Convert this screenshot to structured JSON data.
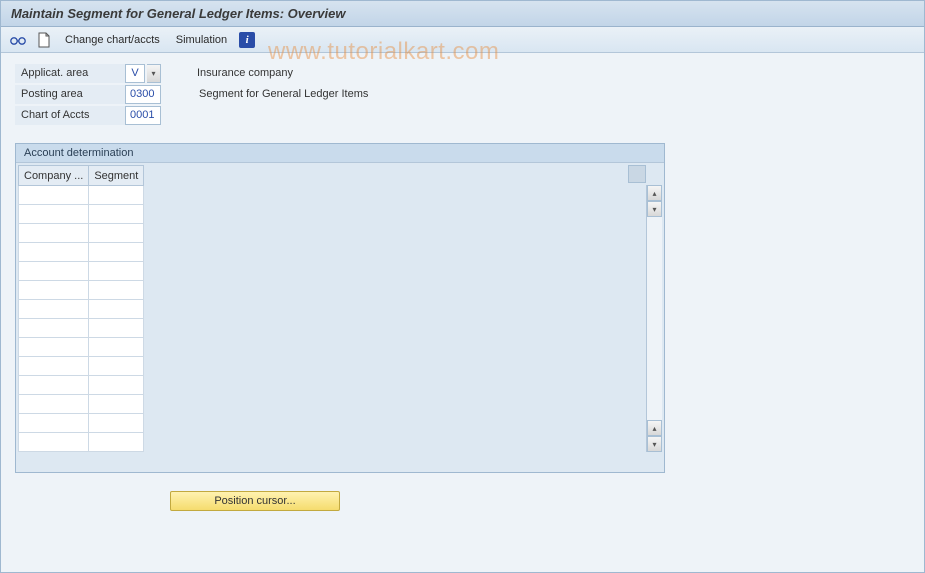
{
  "title": "Maintain Segment for General Ledger Items: Overview",
  "toolbar": {
    "change_chart_label": "Change chart/accts",
    "simulation_label": "Simulation"
  },
  "fields": {
    "applicat_area": {
      "label": "Applicat. area",
      "value": "V",
      "desc": "Insurance company"
    },
    "posting_area": {
      "label": "Posting area",
      "value": "0300",
      "desc": "Segment for General Ledger Items"
    },
    "chart_of_accts": {
      "label": "Chart of Accts",
      "value": "0001",
      "desc": ""
    }
  },
  "panel": {
    "title": "Account determination",
    "columns": {
      "company": "Company ...",
      "segment": "Segment"
    },
    "row_count": 14
  },
  "buttons": {
    "position_cursor": "Position cursor..."
  },
  "watermark": "www.tutorialkart.com"
}
